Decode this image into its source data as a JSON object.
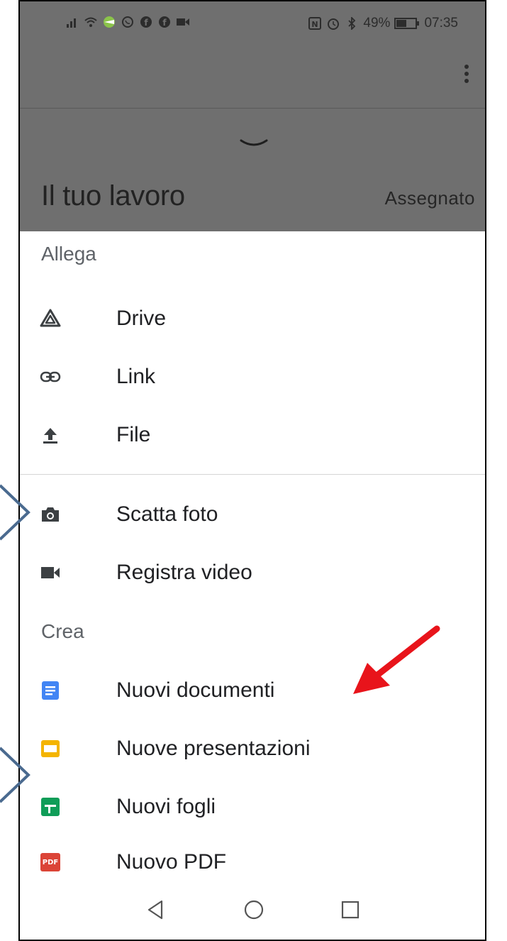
{
  "statusbar": {
    "battery": "49%",
    "time": "07:35"
  },
  "header": {
    "title": "Il tuo lavoro",
    "status": "Assegnato"
  },
  "sections": {
    "attach_label": "Allega",
    "create_label": "Crea"
  },
  "attach_items": [
    {
      "label": "Drive",
      "icon": "drive-icon"
    },
    {
      "label": "Link",
      "icon": "link-icon"
    },
    {
      "label": "File",
      "icon": "upload-icon"
    },
    {
      "label": "Scatta foto",
      "icon": "camera-icon"
    },
    {
      "label": "Registra video",
      "icon": "videocam-icon"
    }
  ],
  "create_items": [
    {
      "label": "Nuovi documenti",
      "icon": "docs-icon",
      "color": "#4285F4"
    },
    {
      "label": "Nuove presentazioni",
      "icon": "slides-icon",
      "color": "#F4B400"
    },
    {
      "label": "Nuovi fogli",
      "icon": "sheets-icon",
      "color": "#0F9D58"
    },
    {
      "label": "Nuovo PDF",
      "icon": "pdf-icon",
      "color": "#DB4437",
      "badge": "PDF"
    }
  ],
  "colors": {
    "scrim": "#6f6f6f",
    "annotation_arrow": "#e8141b",
    "annotation_chevron": "#4a6a8f"
  }
}
